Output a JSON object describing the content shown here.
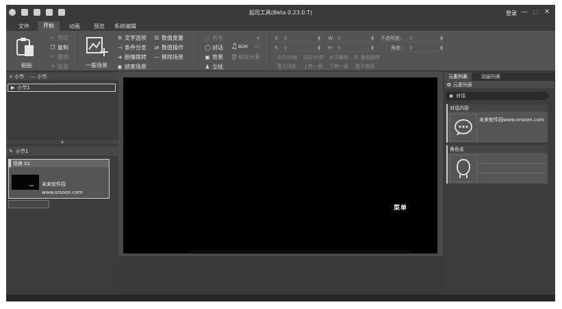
{
  "window": {
    "title": "起司工具(Beta 0.23.0.T)",
    "login": "登录",
    "minimize": "—",
    "restore": "□",
    "close": "✕"
  },
  "menu": [
    "文件",
    "开始",
    "动画",
    "预览",
    "系统编辑"
  ],
  "menu_active": "开始",
  "ribbon": {
    "paste": "粘贴",
    "cut": "剪切",
    "copy": "复制",
    "undo": "撤销",
    "redo": "恢复",
    "general_scene": "一般场景",
    "text_option": "文字选项",
    "condition_branch": "条件分支",
    "plot_jump": "剧情跳转",
    "end_scene": "结束场景",
    "value_variable": "数值变量",
    "value_operation": "数值操作",
    "remove_scene": "移除场景",
    "alias": "名名",
    "dialog": "对话",
    "background": "背景",
    "standing": "立绘",
    "bgm": "BGM",
    "remove_element": "移除元素",
    "x_label": "X:",
    "y_label": "Y:",
    "w_label": "W:",
    "h_label": "H:",
    "x_value": "0",
    "y_value": "0",
    "w_value": "0",
    "h_value": "0",
    "opacity_label": "不透明度:",
    "opacity_value": "0",
    "angle_label": "角度:",
    "angle_value": "0",
    "rotate_left": "向左90度",
    "rotate_right": "向右90度",
    "flip_horizontal": "水平翻转",
    "flip_vertical": "垂直翻转",
    "to_top": "置于顶部",
    "move_up": "上移一层",
    "move_down": "下移一层",
    "to_bottom": "置于底部"
  },
  "left_panel": {
    "add_section": "+ 小节",
    "remove_section": "— 小节",
    "section_item": "小节1",
    "section_header": "小节1",
    "scene_title": "场景 01",
    "scene_text": "未来软件园www.orsoon.com"
  },
  "canvas": {
    "caption": "菜单"
  },
  "right_panel": {
    "tab_elements": "元素列表",
    "tab_animation": "动画列表",
    "sub_header": "元素列表",
    "element_item": "对话",
    "dialog_content_label": "对话内容",
    "dialog_content_text": "未来软件园www.orsoon.com",
    "role_name_label": "角色名"
  }
}
